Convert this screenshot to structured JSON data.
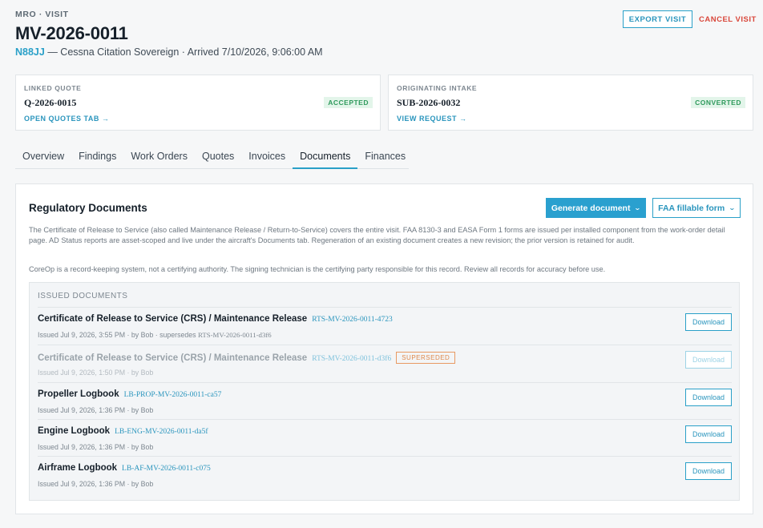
{
  "header": {
    "eyebrow": "MRO · VISIT",
    "title": "MV-2026-0011",
    "tail_number": "N88JJ",
    "subtitle": " — Cessna Citation Sovereign · Arrived 7/10/2026, 9:06:00 AM",
    "export_label": "EXPORT VISIT",
    "cancel_label": "CANCEL VISIT"
  },
  "linked_quote": {
    "label": "LINKED QUOTE",
    "id": "Q-2026-0015",
    "status": "ACCEPTED",
    "link": "OPEN QUOTES TAB →"
  },
  "originating_intake": {
    "label": "ORIGINATING INTAKE",
    "id": "SUB-2026-0032",
    "status": "CONVERTED",
    "link": "VIEW REQUEST →"
  },
  "tabs": [
    {
      "label": "Overview"
    },
    {
      "label": "Findings"
    },
    {
      "label": "Work Orders"
    },
    {
      "label": "Quotes"
    },
    {
      "label": "Invoices"
    },
    {
      "label": "Documents"
    },
    {
      "label": "Finances"
    }
  ],
  "active_tab": "Documents",
  "panel": {
    "title": "Regulatory Documents",
    "generate_label": "Generate document",
    "faa_label": "FAA fillable form",
    "description": "The Certificate of Release to Service (also called Maintenance Release / Return-to-Service) covers the entire visit. FAA 8130-3 and EASA Form 1 forms are issued per installed component from the work-order detail page. AD Status reports are asset-scoped and live under the aircraft's Documents tab. Regeneration of an existing document creates a new revision; the prior version is retained for audit.",
    "disclaimer": "CoreOp is a record-keeping system, not a certifying authority. The signing technician is the certifying party responsible for this record. Review all records for accuracy before use."
  },
  "issued": {
    "header": "ISSUED DOCUMENTS",
    "download_label": "Download",
    "superseded_label": "SUPERSEDED",
    "documents": [
      {
        "name": "Certificate of Release to Service (CRS) / Maintenance Release",
        "code": "RTS-MV-2026-0011-4723",
        "meta": "Issued Jul 9, 2026, 3:55 PM · by Bob · supersedes ",
        "supersedes": "RTS-MV-2026-0011-d3f6"
      },
      {
        "name": "Certificate of Release to Service (CRS) / Maintenance Release",
        "code": "RTS-MV-2026-0011-d3f6",
        "meta": "Issued Jul 9, 2026, 1:50 PM · by Bob",
        "supersedes": ""
      },
      {
        "name": "Propeller Logbook",
        "code": "LB-PROP-MV-2026-0011-ca57",
        "meta": "Issued Jul 9, 2026, 1:36 PM · by Bob",
        "supersedes": ""
      },
      {
        "name": "Engine Logbook",
        "code": "LB-ENG-MV-2026-0011-da5f",
        "meta": "Issued Jul 9, 2026, 1:36 PM · by Bob",
        "supersedes": ""
      },
      {
        "name": "Airframe Logbook",
        "code": "LB-AF-MV-2026-0011-c075",
        "meta": "Issued Jul 9, 2026, 1:36 PM · by Bob",
        "supersedes": ""
      }
    ]
  },
  "colors": {
    "accent": "#2aa0c8",
    "danger": "#d9473b",
    "success_bg": "#e3f5ea",
    "success_text": "#2f9a5c",
    "warning": "#e08a4d"
  }
}
